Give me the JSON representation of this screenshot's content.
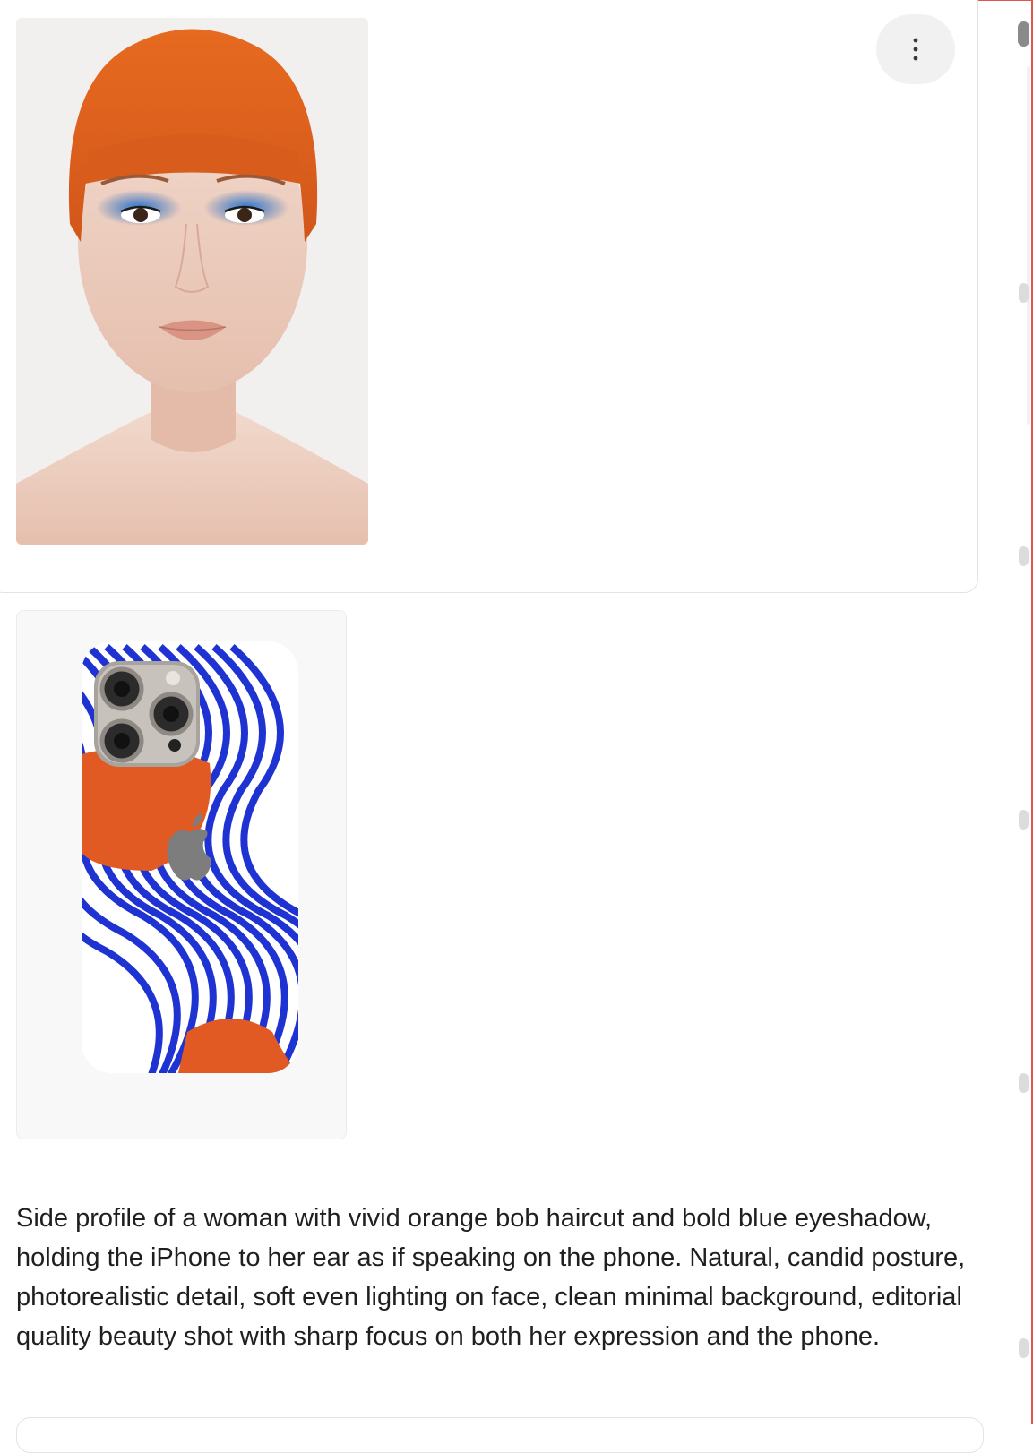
{
  "message": {
    "caption": "Side profile of a woman with vivid orange bob haircut and bold blue eyeshadow, holding the iPhone to her ear as if speaking on the phone. Natural, candid posture, photorealistic detail, soft even lighting on face, clean minimal background, editorial quality beauty shot with sharp focus on both her expression and the phone."
  },
  "icons": {
    "more": "more-vertical-icon",
    "apple_logo": "apple-logo-icon"
  },
  "colors": {
    "hair_orange": "#e5641d",
    "eyeshadow_blue": "#1f6fc9",
    "stripe_blue": "#1e33d1",
    "case_orange": "#e15a24",
    "frame_red": "#e2554f"
  }
}
